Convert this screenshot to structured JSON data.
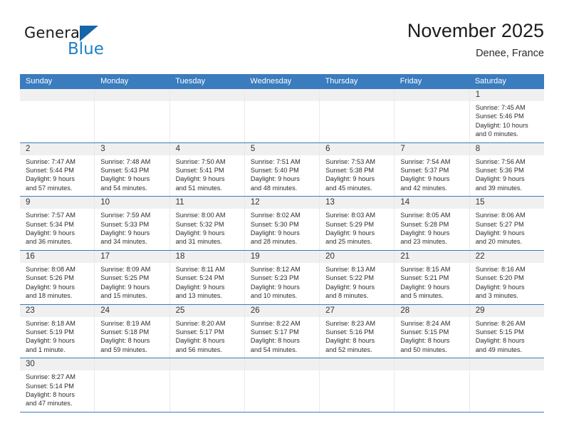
{
  "brand": {
    "name_top": "General",
    "name_bottom": "Blue",
    "accent_color": "#2081c8",
    "triangle_color": "#1565a8"
  },
  "header": {
    "title": "November 2025",
    "subtitle": "Denee, France",
    "header_bg": "#3a7cbe",
    "daynum_bg": "#f0f0f0",
    "separator_color": "#3a7cbe"
  },
  "weekdays": [
    "Sunday",
    "Monday",
    "Tuesday",
    "Wednesday",
    "Thursday",
    "Friday",
    "Saturday"
  ],
  "weeks": [
    [
      {
        "day": "",
        "empty": true
      },
      {
        "day": "",
        "empty": true
      },
      {
        "day": "",
        "empty": true
      },
      {
        "day": "",
        "empty": true
      },
      {
        "day": "",
        "empty": true
      },
      {
        "day": "",
        "empty": true
      },
      {
        "day": "1",
        "sunrise": "Sunrise: 7:45 AM",
        "sunset": "Sunset: 5:46 PM",
        "daylight1": "Daylight: 10 hours",
        "daylight2": "and 0 minutes."
      }
    ],
    [
      {
        "day": "2",
        "sunrise": "Sunrise: 7:47 AM",
        "sunset": "Sunset: 5:44 PM",
        "daylight1": "Daylight: 9 hours",
        "daylight2": "and 57 minutes."
      },
      {
        "day": "3",
        "sunrise": "Sunrise: 7:48 AM",
        "sunset": "Sunset: 5:43 PM",
        "daylight1": "Daylight: 9 hours",
        "daylight2": "and 54 minutes."
      },
      {
        "day": "4",
        "sunrise": "Sunrise: 7:50 AM",
        "sunset": "Sunset: 5:41 PM",
        "daylight1": "Daylight: 9 hours",
        "daylight2": "and 51 minutes."
      },
      {
        "day": "5",
        "sunrise": "Sunrise: 7:51 AM",
        "sunset": "Sunset: 5:40 PM",
        "daylight1": "Daylight: 9 hours",
        "daylight2": "and 48 minutes."
      },
      {
        "day": "6",
        "sunrise": "Sunrise: 7:53 AM",
        "sunset": "Sunset: 5:38 PM",
        "daylight1": "Daylight: 9 hours",
        "daylight2": "and 45 minutes."
      },
      {
        "day": "7",
        "sunrise": "Sunrise: 7:54 AM",
        "sunset": "Sunset: 5:37 PM",
        "daylight1": "Daylight: 9 hours",
        "daylight2": "and 42 minutes."
      },
      {
        "day": "8",
        "sunrise": "Sunrise: 7:56 AM",
        "sunset": "Sunset: 5:36 PM",
        "daylight1": "Daylight: 9 hours",
        "daylight2": "and 39 minutes."
      }
    ],
    [
      {
        "day": "9",
        "sunrise": "Sunrise: 7:57 AM",
        "sunset": "Sunset: 5:34 PM",
        "daylight1": "Daylight: 9 hours",
        "daylight2": "and 36 minutes."
      },
      {
        "day": "10",
        "sunrise": "Sunrise: 7:59 AM",
        "sunset": "Sunset: 5:33 PM",
        "daylight1": "Daylight: 9 hours",
        "daylight2": "and 34 minutes."
      },
      {
        "day": "11",
        "sunrise": "Sunrise: 8:00 AM",
        "sunset": "Sunset: 5:32 PM",
        "daylight1": "Daylight: 9 hours",
        "daylight2": "and 31 minutes."
      },
      {
        "day": "12",
        "sunrise": "Sunrise: 8:02 AM",
        "sunset": "Sunset: 5:30 PM",
        "daylight1": "Daylight: 9 hours",
        "daylight2": "and 28 minutes."
      },
      {
        "day": "13",
        "sunrise": "Sunrise: 8:03 AM",
        "sunset": "Sunset: 5:29 PM",
        "daylight1": "Daylight: 9 hours",
        "daylight2": "and 25 minutes."
      },
      {
        "day": "14",
        "sunrise": "Sunrise: 8:05 AM",
        "sunset": "Sunset: 5:28 PM",
        "daylight1": "Daylight: 9 hours",
        "daylight2": "and 23 minutes."
      },
      {
        "day": "15",
        "sunrise": "Sunrise: 8:06 AM",
        "sunset": "Sunset: 5:27 PM",
        "daylight1": "Daylight: 9 hours",
        "daylight2": "and 20 minutes."
      }
    ],
    [
      {
        "day": "16",
        "sunrise": "Sunrise: 8:08 AM",
        "sunset": "Sunset: 5:26 PM",
        "daylight1": "Daylight: 9 hours",
        "daylight2": "and 18 minutes."
      },
      {
        "day": "17",
        "sunrise": "Sunrise: 8:09 AM",
        "sunset": "Sunset: 5:25 PM",
        "daylight1": "Daylight: 9 hours",
        "daylight2": "and 15 minutes."
      },
      {
        "day": "18",
        "sunrise": "Sunrise: 8:11 AM",
        "sunset": "Sunset: 5:24 PM",
        "daylight1": "Daylight: 9 hours",
        "daylight2": "and 13 minutes."
      },
      {
        "day": "19",
        "sunrise": "Sunrise: 8:12 AM",
        "sunset": "Sunset: 5:23 PM",
        "daylight1": "Daylight: 9 hours",
        "daylight2": "and 10 minutes."
      },
      {
        "day": "20",
        "sunrise": "Sunrise: 8:13 AM",
        "sunset": "Sunset: 5:22 PM",
        "daylight1": "Daylight: 9 hours",
        "daylight2": "and 8 minutes."
      },
      {
        "day": "21",
        "sunrise": "Sunrise: 8:15 AM",
        "sunset": "Sunset: 5:21 PM",
        "daylight1": "Daylight: 9 hours",
        "daylight2": "and 5 minutes."
      },
      {
        "day": "22",
        "sunrise": "Sunrise: 8:16 AM",
        "sunset": "Sunset: 5:20 PM",
        "daylight1": "Daylight: 9 hours",
        "daylight2": "and 3 minutes."
      }
    ],
    [
      {
        "day": "23",
        "sunrise": "Sunrise: 8:18 AM",
        "sunset": "Sunset: 5:19 PM",
        "daylight1": "Daylight: 9 hours",
        "daylight2": "and 1 minute."
      },
      {
        "day": "24",
        "sunrise": "Sunrise: 8:19 AM",
        "sunset": "Sunset: 5:18 PM",
        "daylight1": "Daylight: 8 hours",
        "daylight2": "and 59 minutes."
      },
      {
        "day": "25",
        "sunrise": "Sunrise: 8:20 AM",
        "sunset": "Sunset: 5:17 PM",
        "daylight1": "Daylight: 8 hours",
        "daylight2": "and 56 minutes."
      },
      {
        "day": "26",
        "sunrise": "Sunrise: 8:22 AM",
        "sunset": "Sunset: 5:17 PM",
        "daylight1": "Daylight: 8 hours",
        "daylight2": "and 54 minutes."
      },
      {
        "day": "27",
        "sunrise": "Sunrise: 8:23 AM",
        "sunset": "Sunset: 5:16 PM",
        "daylight1": "Daylight: 8 hours",
        "daylight2": "and 52 minutes."
      },
      {
        "day": "28",
        "sunrise": "Sunrise: 8:24 AM",
        "sunset": "Sunset: 5:15 PM",
        "daylight1": "Daylight: 8 hours",
        "daylight2": "and 50 minutes."
      },
      {
        "day": "29",
        "sunrise": "Sunrise: 8:26 AM",
        "sunset": "Sunset: 5:15 PM",
        "daylight1": "Daylight: 8 hours",
        "daylight2": "and 49 minutes."
      }
    ],
    [
      {
        "day": "30",
        "sunrise": "Sunrise: 8:27 AM",
        "sunset": "Sunset: 5:14 PM",
        "daylight1": "Daylight: 8 hours",
        "daylight2": "and 47 minutes."
      },
      {
        "day": "",
        "empty": true
      },
      {
        "day": "",
        "empty": true
      },
      {
        "day": "",
        "empty": true
      },
      {
        "day": "",
        "empty": true
      },
      {
        "day": "",
        "empty": true
      },
      {
        "day": "",
        "empty": true
      }
    ]
  ]
}
